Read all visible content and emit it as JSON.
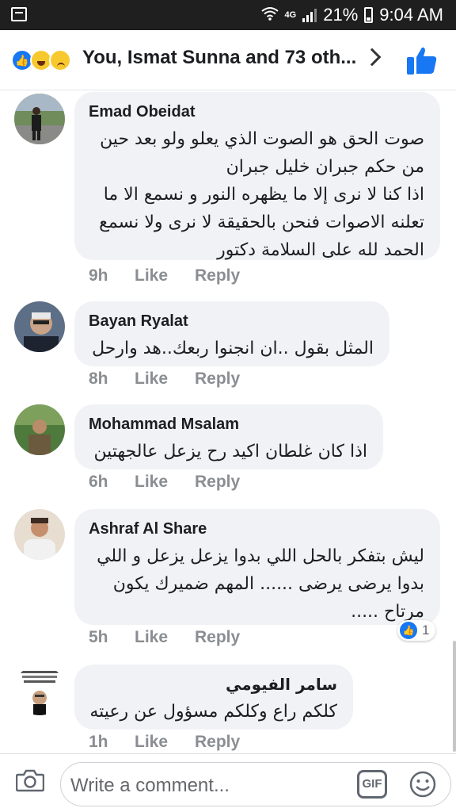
{
  "status_bar": {
    "network": "4G",
    "battery": "21%",
    "time": "9:04 AM"
  },
  "header": {
    "title": "You, Ismat Sunna and 73 oth...",
    "reactions": [
      "like-icon",
      "haha-icon",
      "sad-icon"
    ]
  },
  "comments": [
    {
      "author": "Emad Obeidat",
      "lines": [
        "صوت الحق هو الصوت الذي يعلو ولو بعد حين",
        "من حكم جبران خليل جبران",
        "اذا كنا لا نرى إلا ما يظهره النور و نسمع الا ما",
        "تعلنه الاصوات فنحن بالحقيقة لا نرى ولا نسمع",
        "الحمد لله على السلامة دكتور"
      ],
      "time": "9h",
      "like": "Like",
      "reply": "Reply"
    },
    {
      "author": "Bayan Ryalat",
      "lines": [
        "المثل بقول ..ان انجنوا ربعك..هد وارحل"
      ],
      "time": "8h",
      "like": "Like",
      "reply": "Reply"
    },
    {
      "author": "Mohammad Msalam",
      "lines": [
        "اذا كان غلطان اكيد رح يزعل عالجهتين"
      ],
      "time": "6h",
      "like": "Like",
      "reply": "Reply"
    },
    {
      "author": "Ashraf Al Share",
      "lines": [
        "ليش بتفكر بالحل اللي بدوا يزعل يزعل و اللي",
        "بدوا يرضى يرضى ...... المهم ضميرك يكون",
        "مرتاح ....."
      ],
      "time": "5h",
      "like": "Like",
      "reply": "Reply",
      "reaction_count": "1"
    },
    {
      "author": "سامر الفيومي",
      "lines": [
        "كلكم راع وكلكم مسؤول عن رعيته"
      ],
      "time": "1h",
      "like": "Like",
      "reply": "Reply"
    }
  ],
  "composer": {
    "placeholder": "Write a comment...",
    "gif_label": "GIF"
  },
  "colors": {
    "status_bar": "#1f1f1f",
    "bubble": "#f0f2f5",
    "facebook_blue": "#1877f2",
    "meta_text": "#8a8d91"
  }
}
